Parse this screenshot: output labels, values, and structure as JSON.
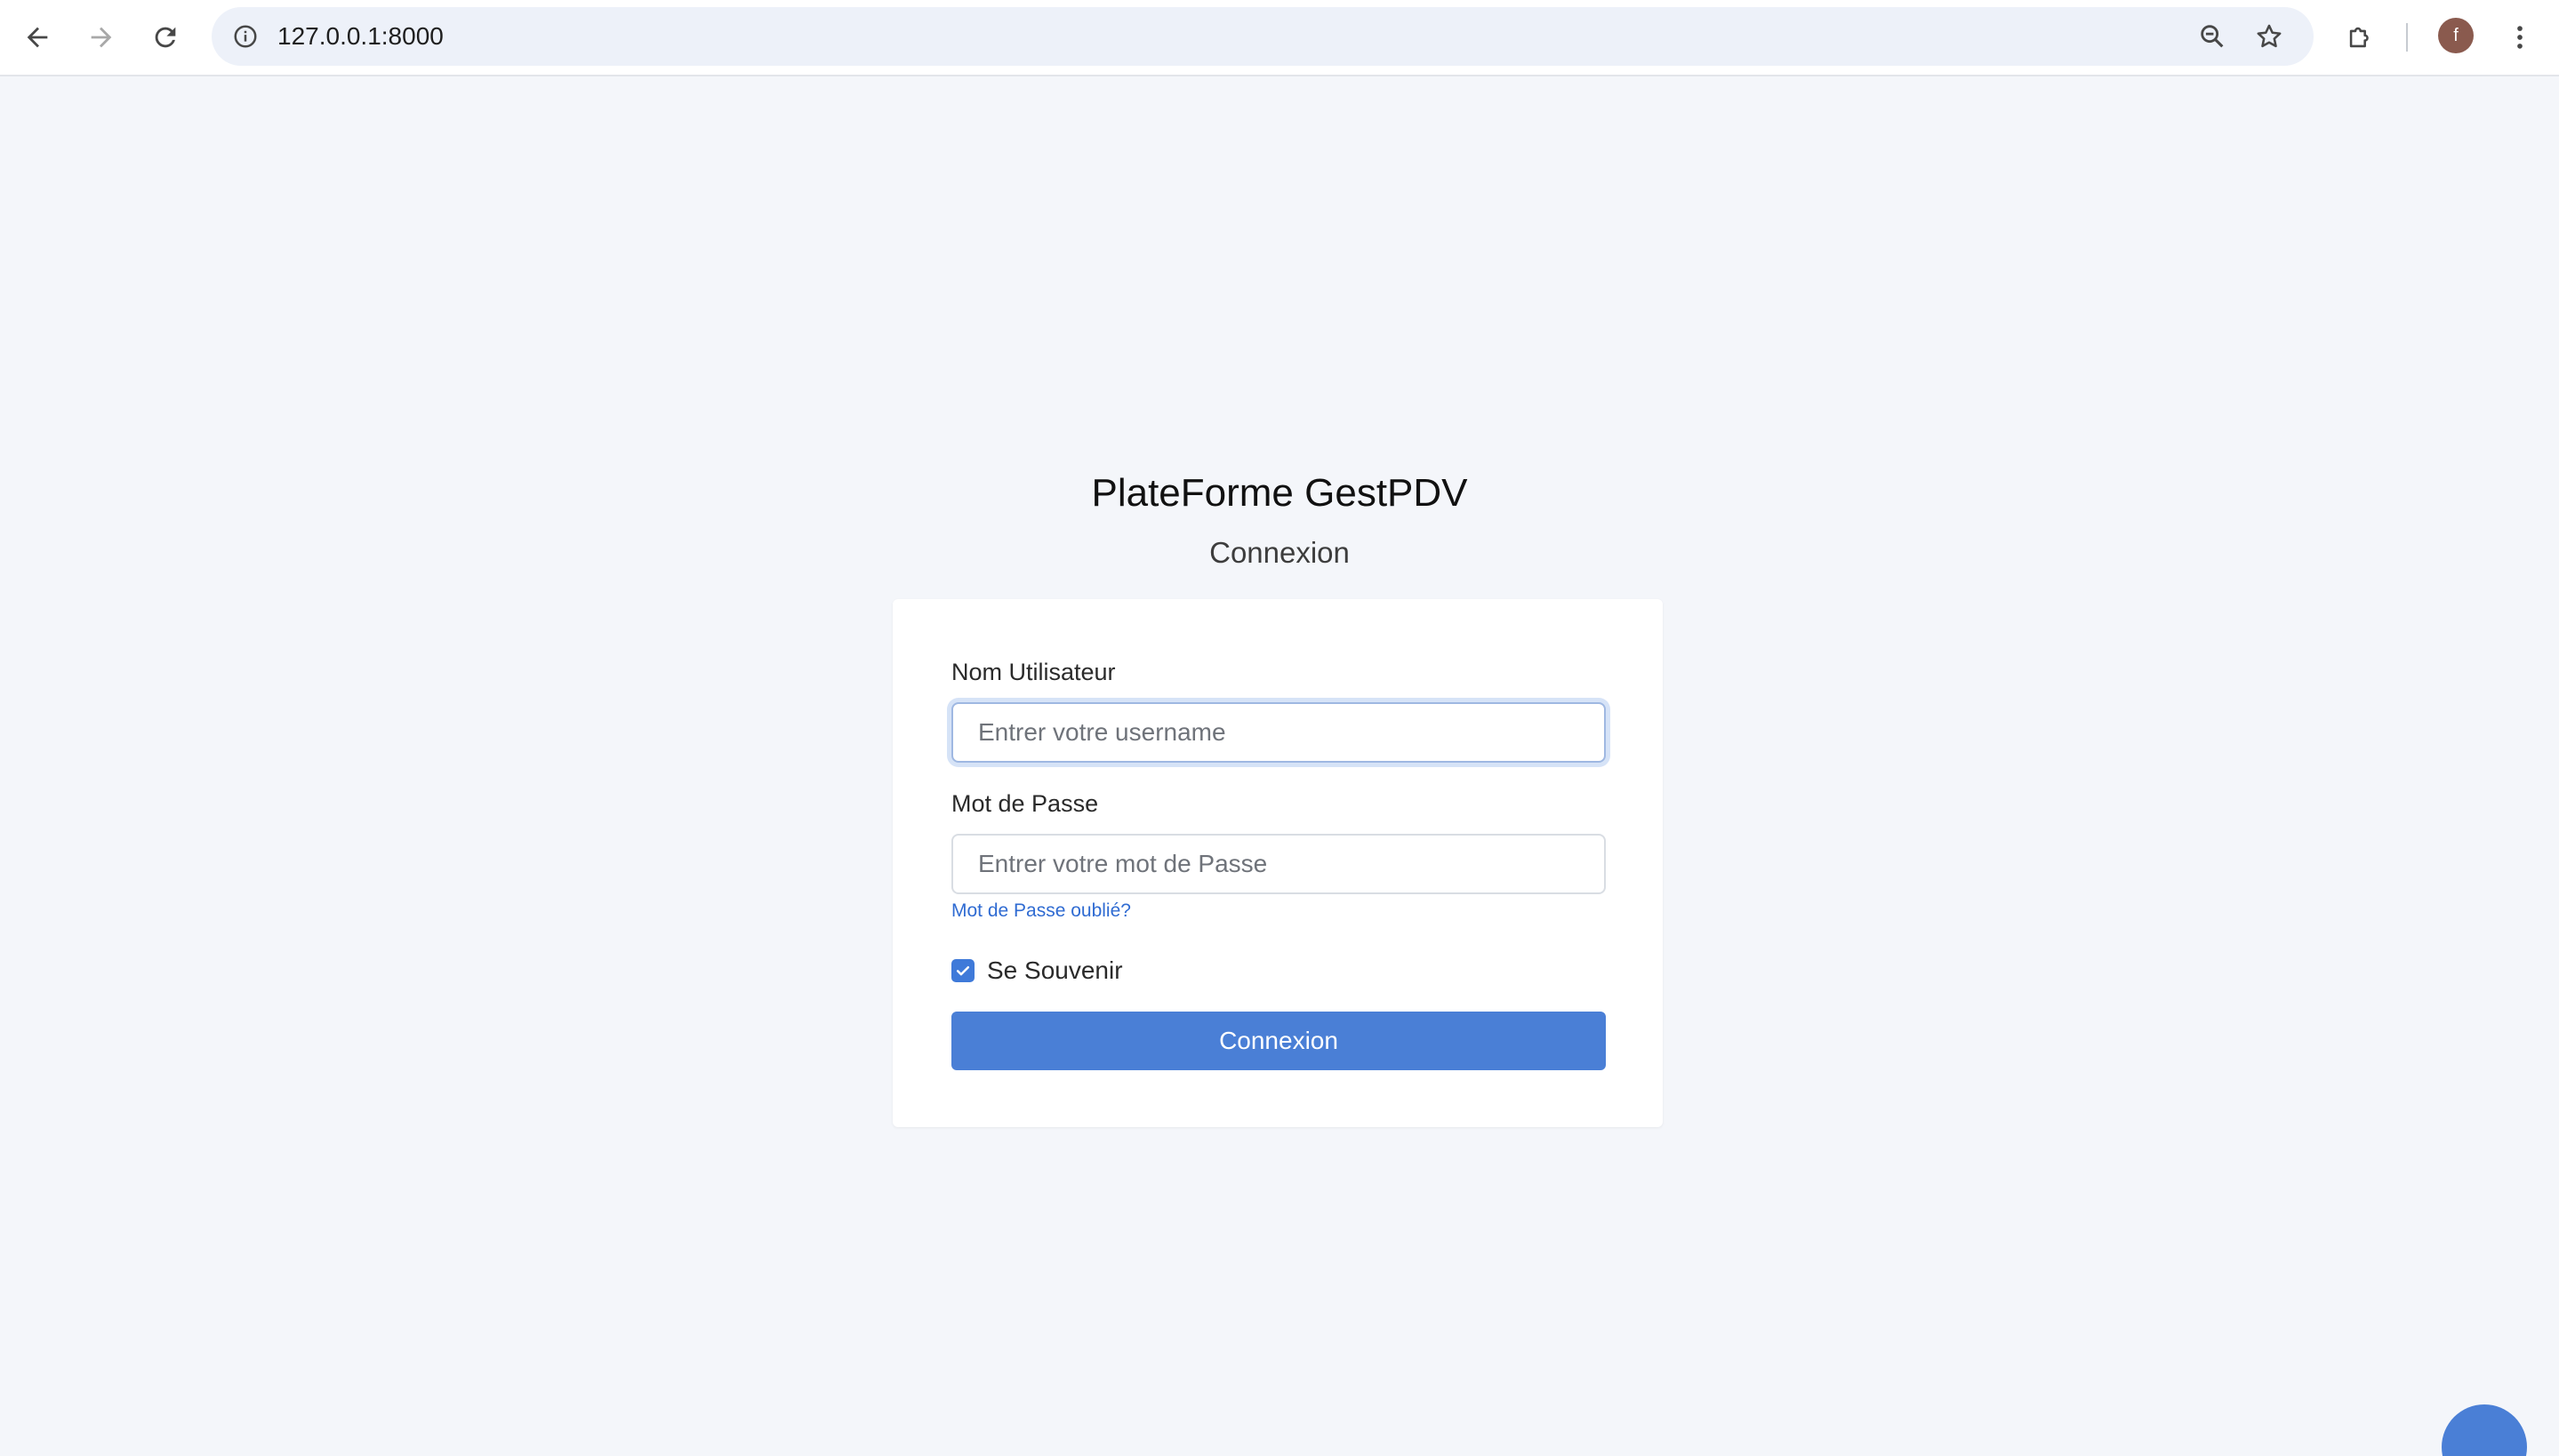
{
  "browser": {
    "url": "127.0.0.1:8000",
    "avatar_initial": "f",
    "icons": {
      "back": "arrow-left-icon",
      "forward": "arrow-right-icon",
      "reload": "reload-icon",
      "site_info": "info-icon",
      "zoom": "zoom-out-icon",
      "bookmark": "star-icon",
      "extensions": "puzzle-icon",
      "menu": "kebab-menu-icon"
    }
  },
  "page": {
    "title": "PlateForme GestPDV",
    "subtitle": "Connexion"
  },
  "login_form": {
    "username": {
      "label": "Nom Utilisateur",
      "placeholder": "Entrer votre username",
      "value": ""
    },
    "password": {
      "label": "Mot de Passe",
      "placeholder": "Entrer votre mot de Passe",
      "value": ""
    },
    "forgot_link": "Mot de Passe oublié?",
    "remember_label": "Se Souvenir",
    "remember_checked": true,
    "submit_label": "Connexion"
  },
  "colors": {
    "accent": "#4a7fd6",
    "link": "#2f6bd2",
    "background": "#f4f6fa"
  }
}
